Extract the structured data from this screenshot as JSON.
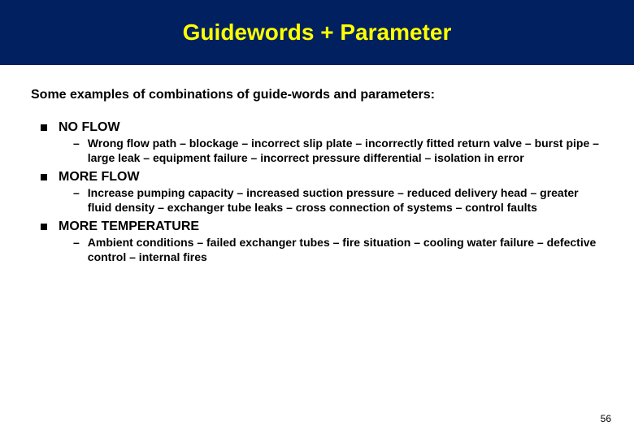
{
  "header": {
    "title": "Guidewords + Parameter"
  },
  "intro": "Some examples of combinations of guide-words and parameters:",
  "examples": [
    {
      "heading": "NO FLOW",
      "detail": "Wrong flow path – blockage – incorrect slip plate – incorrectly fitted return valve – burst pipe – large leak – equipment failure – incorrect pressure differential – isolation in error"
    },
    {
      "heading": "MORE FLOW",
      "detail": "Increase pumping capacity – increased suction pressure – reduced delivery head – greater fluid density – exchanger tube leaks – cross connection of systems – control faults"
    },
    {
      "heading": "MORE TEMPERATURE",
      "detail": "Ambient conditions – failed exchanger tubes – fire situation – cooling water failure – defective control – internal fires"
    }
  ],
  "page_number": "56"
}
